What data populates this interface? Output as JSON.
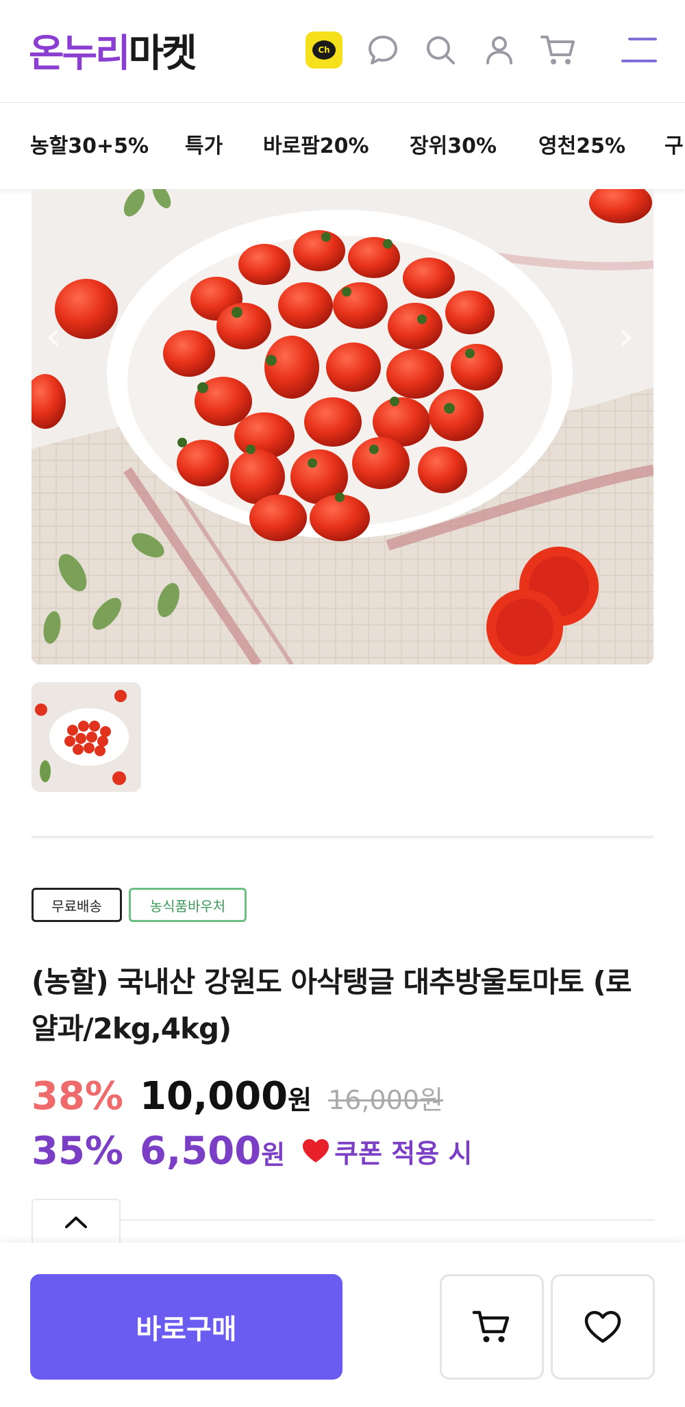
{
  "header": {
    "logo_part1": "온누리",
    "logo_part2": "마켓",
    "icons": [
      "kakao-channel-icon",
      "chat-icon",
      "search-icon",
      "user-icon",
      "cart-icon",
      "menu-icon"
    ],
    "kakao_badge_text": "Ch"
  },
  "categories": [
    "농할30+5%",
    "특가",
    "바로팜20%",
    "장위30%",
    "영천25%",
    "구"
  ],
  "badges": {
    "free_shipping": "무료배송",
    "voucher": "농식품바우처"
  },
  "product": {
    "title": "(농할) 국내산 강원도 아삭탱글 대추방울토마토 (로얄과/2kg,4kg)"
  },
  "price": {
    "discount_pct": "38%",
    "sale_price": "10,000",
    "won": "원",
    "original_price": "16,000원",
    "coupon_pct": "35%",
    "coupon_price": "6,500",
    "coupon_won": "원",
    "coupon_label": "쿠폰 적용 시"
  },
  "actions": {
    "buy_now": "바로구매"
  },
  "colors": {
    "brand_purple": "#8a3fd1",
    "discount_red": "#ef6a6a",
    "coupon_purple": "#7a3fc4",
    "buy_button": "#6b5cf1",
    "voucher_green": "#3e9a5a",
    "kakao_yellow": "#f6e01b"
  }
}
